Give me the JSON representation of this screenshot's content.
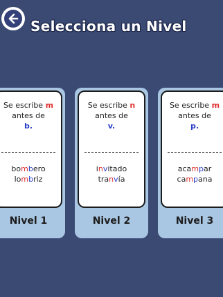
{
  "header": {
    "title": "Selecciona un Nivel"
  },
  "colors": {
    "background": "#3b4a73",
    "card": "#a9c6e2",
    "highlight_letter": "#e03030",
    "highlight_next": "#2a40c8"
  },
  "cards": [
    {
      "rule_prefix": "Se escribe",
      "letter": "m",
      "rule_middle": "antes de",
      "next": "b.",
      "divider": "-------------------",
      "examples": [
        {
          "pre": "bo",
          "hl1": "m",
          "hl2": "b",
          "post": "ero"
        },
        {
          "pre": "lo",
          "hl1": "m",
          "hl2": "b",
          "post": "riz"
        }
      ],
      "level": "Nivel 1"
    },
    {
      "rule_prefix": "Se escribe",
      "letter": "n",
      "rule_middle": "antes de",
      "next": "v.",
      "divider": "-------------------",
      "examples": [
        {
          "pre": "i",
          "hl1": "n",
          "hl2": "v",
          "post": "itado"
        },
        {
          "pre": "tra",
          "hl1": "n",
          "hl2": "v",
          "post": "ía"
        }
      ],
      "level": "Nivel 2"
    },
    {
      "rule_prefix": "Se escribe",
      "letter": "m",
      "rule_middle": "antes de",
      "next": "p.",
      "divider": "-------------------",
      "examples": [
        {
          "pre": "aca",
          "hl1": "m",
          "hl2": "p",
          "post": "ar"
        },
        {
          "pre": "ca",
          "hl1": "m",
          "hl2": "p",
          "post": "ana"
        }
      ],
      "level": "Nivel 3"
    }
  ]
}
